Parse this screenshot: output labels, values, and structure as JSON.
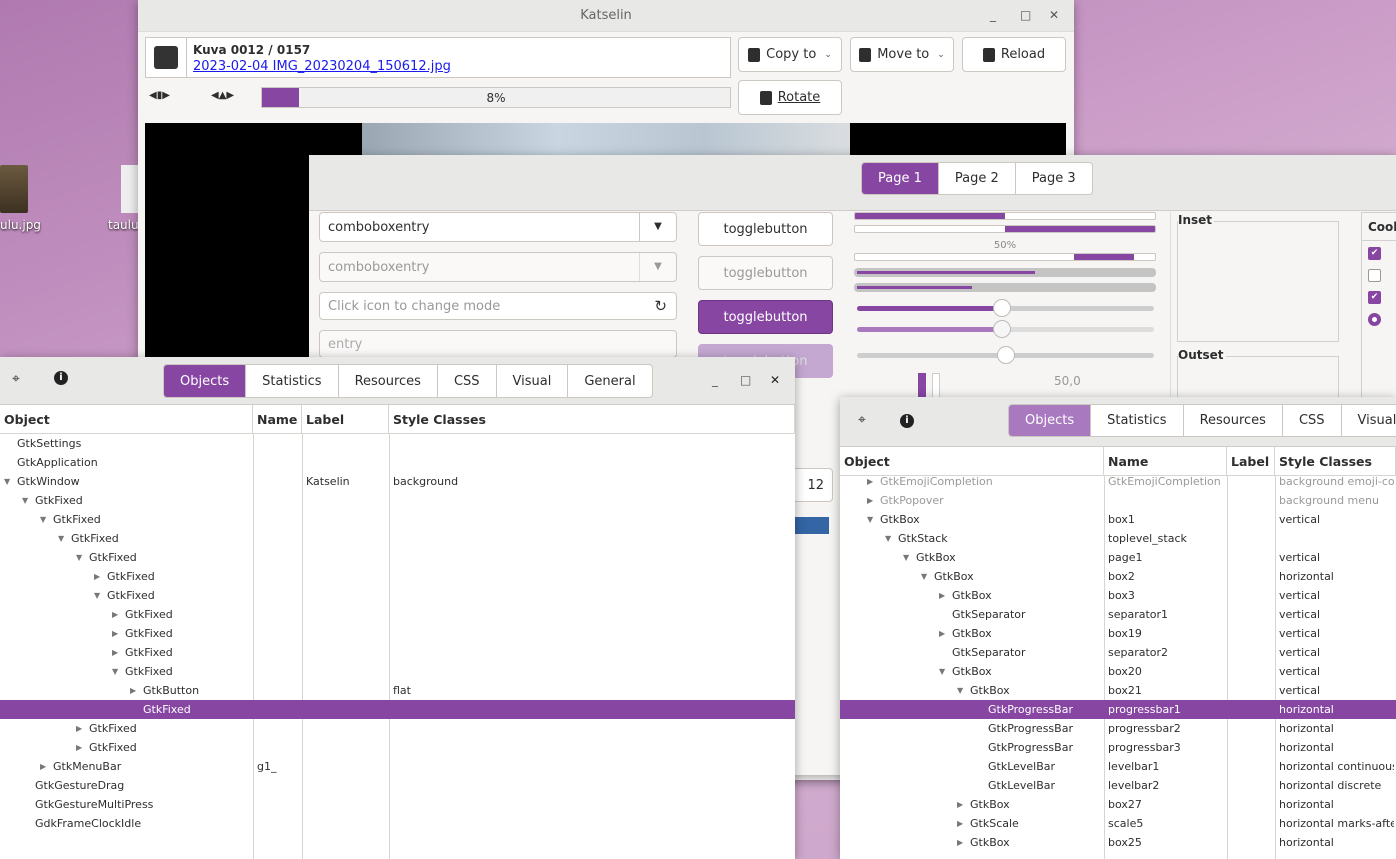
{
  "desktop": {
    "icons": [
      {
        "label": "ulu.jpg"
      },
      {
        "label": "taulu"
      }
    ]
  },
  "viewer": {
    "title": "Katselin",
    "counter": "Kuva 0012 / 0157",
    "filename": "2023-02-04 IMG_20230204_150612.jpg",
    "progress_text": "8%",
    "progress": 8,
    "copy_label": "Copy to",
    "move_label": "Move to",
    "reload_label": "Reload",
    "rotate_label": "Rotate"
  },
  "demo": {
    "pages": [
      "Page 1",
      "Page 2",
      "Page 3"
    ],
    "combo1": "comboboxentry",
    "combo2": "comboboxentry",
    "entry_placeholder": "Click icon to change mode",
    "entry2_placeholder": "entry",
    "toggles": [
      "togglebutton",
      "togglebutton",
      "togglebutton",
      "togglebutton"
    ],
    "progress_label": "50%",
    "scale_value": "50,0",
    "spin_value": "12",
    "inset_label": "Inset",
    "outset_label": "Outset",
    "cool_label": "Cool",
    "accent": "#8646a2"
  },
  "inspector_left": {
    "tabs": [
      "Objects",
      "Statistics",
      "Resources",
      "CSS",
      "Visual",
      "General"
    ],
    "columns": [
      "Object",
      "Name",
      "Label",
      "Style Classes"
    ],
    "rows": [
      {
        "object": "GtkSettings",
        "name": "",
        "label": "",
        "style": "",
        "depth": 0,
        "expander": ""
      },
      {
        "object": "GtkApplication",
        "name": "",
        "label": "",
        "style": "",
        "depth": 0,
        "expander": ""
      },
      {
        "object": "GtkWindow",
        "name": "",
        "label": "Katselin",
        "style": "background",
        "depth": 0,
        "expander": "open"
      },
      {
        "object": "GtkFixed",
        "name": "",
        "label": "",
        "style": "",
        "depth": 1,
        "expander": "open"
      },
      {
        "object": "GtkFixed",
        "name": "",
        "label": "",
        "style": "",
        "depth": 2,
        "expander": "open"
      },
      {
        "object": "GtkFixed",
        "name": "",
        "label": "",
        "style": "",
        "depth": 3,
        "expander": "open"
      },
      {
        "object": "GtkFixed",
        "name": "",
        "label": "",
        "style": "",
        "depth": 4,
        "expander": "open"
      },
      {
        "object": "GtkFixed",
        "name": "",
        "label": "",
        "style": "",
        "depth": 5,
        "expander": "closed"
      },
      {
        "object": "GtkFixed",
        "name": "",
        "label": "",
        "style": "",
        "depth": 5,
        "expander": "open"
      },
      {
        "object": "GtkFixed",
        "name": "",
        "label": "",
        "style": "",
        "depth": 6,
        "expander": "closed"
      },
      {
        "object": "GtkFixed",
        "name": "",
        "label": "",
        "style": "",
        "depth": 6,
        "expander": "closed"
      },
      {
        "object": "GtkFixed",
        "name": "",
        "label": "",
        "style": "",
        "depth": 6,
        "expander": "closed"
      },
      {
        "object": "GtkFixed",
        "name": "",
        "label": "",
        "style": "",
        "depth": 6,
        "expander": "open"
      },
      {
        "object": "GtkButton",
        "name": "",
        "label": "",
        "style": "flat",
        "depth": 7,
        "expander": "closed"
      },
      {
        "object": "GtkFixed",
        "name": "",
        "label": "",
        "style": "",
        "depth": 7,
        "expander": "",
        "selected": true
      },
      {
        "object": "GtkFixed",
        "name": "",
        "label": "",
        "style": "",
        "depth": 4,
        "expander": "closed"
      },
      {
        "object": "GtkFixed",
        "name": "",
        "label": "",
        "style": "",
        "depth": 4,
        "expander": "closed"
      },
      {
        "object": "GtkMenuBar",
        "name": "g1_",
        "label": "",
        "style": "",
        "depth": 2,
        "expander": "closed"
      },
      {
        "object": "GtkGestureDrag",
        "name": "",
        "label": "",
        "style": "",
        "depth": 1,
        "expander": ""
      },
      {
        "object": "GtkGestureMultiPress",
        "name": "",
        "label": "",
        "style": "",
        "depth": 1,
        "expander": ""
      },
      {
        "object": "GdkFrameClockIdle",
        "name": "",
        "label": "",
        "style": "",
        "depth": 1,
        "expander": ""
      }
    ]
  },
  "inspector_right": {
    "tabs": [
      "Objects",
      "Statistics",
      "Resources",
      "CSS",
      "Visual"
    ],
    "columns": [
      "Object",
      "Name",
      "Label",
      "Style Classes"
    ],
    "rows": [
      {
        "object": "GtkEmojiCompletion",
        "name": "GtkEmojiCompletion",
        "label": "",
        "style": "background emoji-completion",
        "depth": 0,
        "expander": "closed",
        "dim": true
      },
      {
        "object": "GtkPopover",
        "name": "",
        "label": "",
        "style": "background menu",
        "depth": 0,
        "expander": "closed",
        "dim": true
      },
      {
        "object": "GtkBox",
        "name": "box1",
        "label": "",
        "style": "vertical",
        "depth": 0,
        "expander": "open"
      },
      {
        "object": "GtkStack",
        "name": "toplevel_stack",
        "label": "",
        "style": "",
        "depth": 1,
        "expander": "open"
      },
      {
        "object": "GtkBox",
        "name": "page1",
        "label": "",
        "style": "vertical",
        "depth": 2,
        "expander": "open"
      },
      {
        "object": "GtkBox",
        "name": "box2",
        "label": "",
        "style": "horizontal",
        "depth": 3,
        "expander": "open"
      },
      {
        "object": "GtkBox",
        "name": "box3",
        "label": "",
        "style": "vertical",
        "depth": 4,
        "expander": "closed"
      },
      {
        "object": "GtkSeparator",
        "name": "separator1",
        "label": "",
        "style": "vertical",
        "depth": 4,
        "expander": ""
      },
      {
        "object": "GtkBox",
        "name": "box19",
        "label": "",
        "style": "vertical",
        "depth": 4,
        "expander": "closed"
      },
      {
        "object": "GtkSeparator",
        "name": "separator2",
        "label": "",
        "style": "vertical",
        "depth": 4,
        "expander": ""
      },
      {
        "object": "GtkBox",
        "name": "box20",
        "label": "",
        "style": "vertical",
        "depth": 4,
        "expander": "open"
      },
      {
        "object": "GtkBox",
        "name": "box21",
        "label": "",
        "style": "vertical",
        "depth": 5,
        "expander": "open"
      },
      {
        "object": "GtkProgressBar",
        "name": "progressbar1",
        "label": "",
        "style": "horizontal",
        "depth": 6,
        "expander": "",
        "selected": true
      },
      {
        "object": "GtkProgressBar",
        "name": "progressbar2",
        "label": "",
        "style": "horizontal",
        "depth": 6,
        "expander": ""
      },
      {
        "object": "GtkProgressBar",
        "name": "progressbar3",
        "label": "",
        "style": "horizontal",
        "depth": 6,
        "expander": ""
      },
      {
        "object": "GtkLevelBar",
        "name": "levelbar1",
        "label": "",
        "style": "horizontal continuous",
        "depth": 6,
        "expander": ""
      },
      {
        "object": "GtkLevelBar",
        "name": "levelbar2",
        "label": "",
        "style": "horizontal discrete",
        "depth": 6,
        "expander": ""
      },
      {
        "object": "GtkBox",
        "name": "box27",
        "label": "",
        "style": "horizontal",
        "depth": 5,
        "expander": "closed"
      },
      {
        "object": "GtkScale",
        "name": "scale5",
        "label": "",
        "style": "horizontal marks-after",
        "depth": 5,
        "expander": "closed"
      },
      {
        "object": "GtkBox",
        "name": "box25",
        "label": "",
        "style": "horizontal",
        "depth": 5,
        "expander": "closed"
      }
    ]
  }
}
